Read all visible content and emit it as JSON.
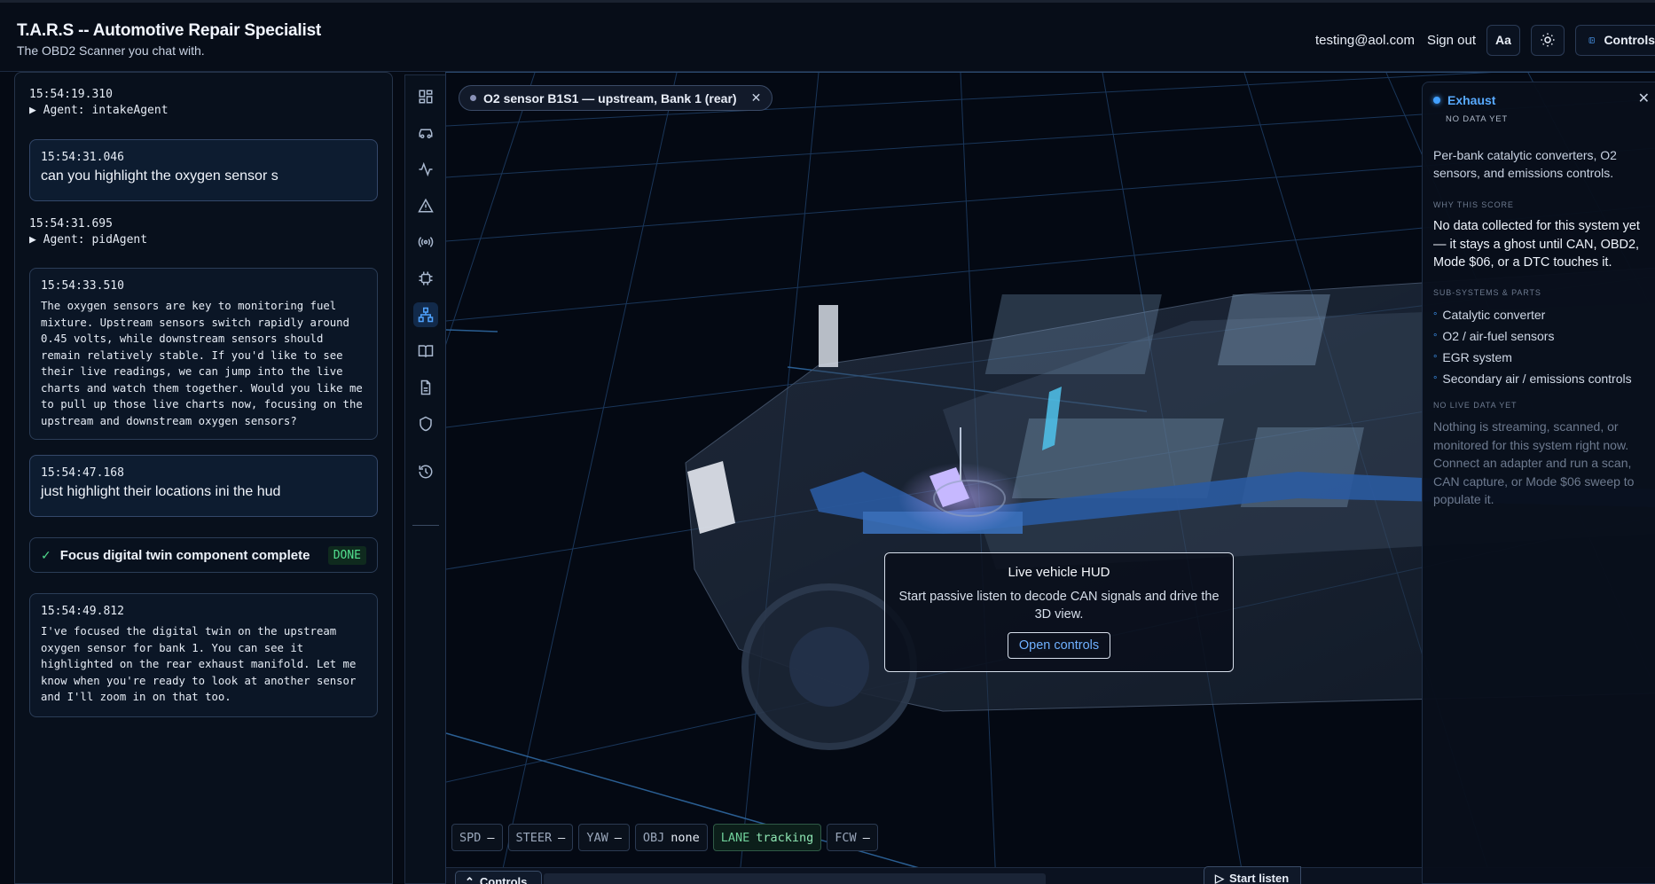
{
  "header": {
    "title": "T.A.R.S -- Automotive Repair Specialist",
    "subtitle": "The OBD2 Scanner you chat with.",
    "user_email": "testing@aol.com",
    "sign_out": "Sign out",
    "font_button": "Aa",
    "controls_button": "Controls"
  },
  "chat": {
    "messages": [
      {
        "time": "15:54:19.310",
        "agent": "▶ Agent: intakeAgent"
      },
      {
        "time": "15:54:31.046",
        "text": "can you highlight the oxygen sensor s"
      },
      {
        "time": "15:54:31.695",
        "agent": "▶ Agent: pidAgent"
      },
      {
        "time": "15:54:33.510",
        "text": "The oxygen sensors are key to monitoring fuel mixture. Upstream sensors switch rapidly around 0.45 volts, while downstream sensors should remain relatively stable. If you'd like to see their live readings, we can jump into the live charts and watch them together. Would you like me to pull up those live charts now, focusing on the upstream and downstream oxygen sensors?"
      },
      {
        "time": "15:54:47.168",
        "text": "just highlight their locations ini the hud"
      },
      {
        "status": "Focus digital twin component complete",
        "badge": "DONE"
      },
      {
        "time": "15:54:49.812",
        "text": "I've focused the digital twin on the upstream oxygen sensor for bank 1. You can see it highlighted on the rear exhaust manifold. Let me know when you're ready to look at another sensor and I'll zoom in on that too."
      }
    ]
  },
  "rail": {
    "icons": [
      "dashboard-icon",
      "car-icon",
      "pulse-icon",
      "warning-icon",
      "signal-icon",
      "chip-icon",
      "network-icon",
      "book-icon",
      "document-icon",
      "shield-icon",
      "history-icon"
    ],
    "active": "network-icon"
  },
  "viewport": {
    "focus_chip": "O2 sensor B1S1 — upstream, Bank 1 (rear)",
    "hud": {
      "title": "Live vehicle HUD",
      "text": "Start passive listen to decode CAN signals and drive the 3D view.",
      "button": "Open controls"
    },
    "telemetry": [
      {
        "label": "SPD",
        "value": "—"
      },
      {
        "label": "STEER",
        "value": "—"
      },
      {
        "label": "YAW",
        "value": "—"
      },
      {
        "label": "OBJ",
        "value": "none"
      },
      {
        "label": "LANE",
        "value": "tracking"
      },
      {
        "label": "FCW",
        "value": "—"
      }
    ],
    "controls_tab": "Controls",
    "start_listen": "Start listen"
  },
  "info": {
    "title": "Exhaust",
    "status": "NO DATA YET",
    "description": "Per-bank catalytic converters, O2 sensors, and emissions controls.",
    "why_heading": "WHY THIS SCORE",
    "why_text": "No data collected for this system yet — it stays a ghost until CAN, OBD2, Mode $06, or a DTC touches it.",
    "parts_heading": "SUB-SYSTEMS & PARTS",
    "parts": [
      "Catalytic converter",
      "O2 / air-fuel sensors",
      "EGR system",
      "Secondary air / emissions controls"
    ],
    "live_heading": "NO LIVE DATA YET",
    "live_text": "Nothing is streaming, scanned, or monitored for this system right now. Connect an adapter and run a scan, CAN capture, or Mode $06 sweep to populate it."
  },
  "colors": {
    "accent": "#4fa3ff",
    "done": "#52e08f",
    "background": "#050a14"
  }
}
